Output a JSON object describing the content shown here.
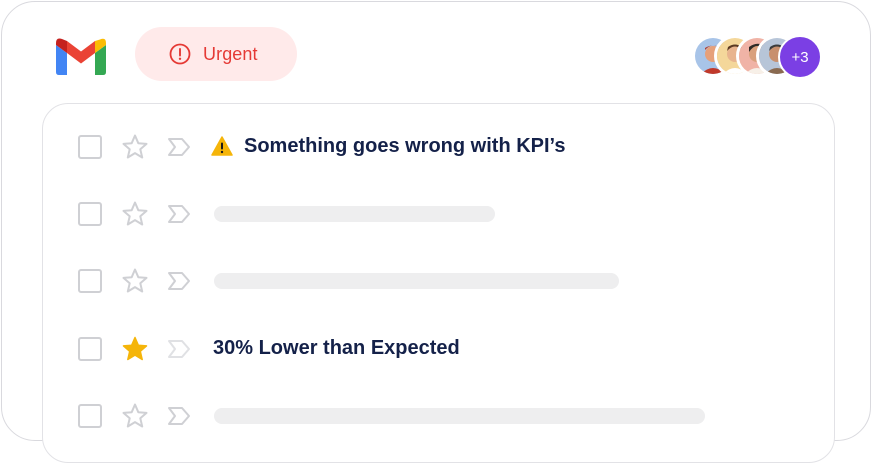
{
  "header": {
    "logo_icon": "gmail-logo",
    "filter_chip": {
      "icon": "alert-circle-icon",
      "label": "Urgent",
      "color": "#e53935",
      "background": "#ffeaea"
    },
    "avatars": {
      "more_label": "+3",
      "more_color": "#7b3fe4"
    }
  },
  "messages": [
    {
      "starred": false,
      "has_warning_icon": true,
      "subject": "Something goes wrong with KPI’s"
    },
    {
      "starred": false,
      "subject": null
    },
    {
      "starred": false,
      "subject": null
    },
    {
      "starred": true,
      "star_color": "#f5b50a",
      "subject": "30% Lower than Expected"
    },
    {
      "starred": false,
      "subject": null
    }
  ]
}
